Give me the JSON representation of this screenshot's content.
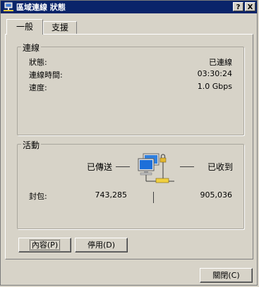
{
  "window": {
    "title": "區域連線 狀態",
    "help_label": "?",
    "close_label": "X"
  },
  "tabs": [
    {
      "label": "一般"
    },
    {
      "label": "支援"
    }
  ],
  "connection": {
    "group_label": "連線",
    "rows": [
      {
        "label": "狀態:",
        "value": "已連線"
      },
      {
        "label": "連線時間:",
        "value": "03:30:24"
      },
      {
        "label": "速度:",
        "value": "1.0 Gbps"
      }
    ]
  },
  "activity": {
    "group_label": "活動",
    "sent_label": "已傳送",
    "received_label": "已收到",
    "packets_label": "封包:",
    "packets_sent": "743,285",
    "packets_received": "905,036"
  },
  "buttons": {
    "properties": "內容(P)",
    "disable": "停用(D)",
    "close": "關閉(C)"
  }
}
